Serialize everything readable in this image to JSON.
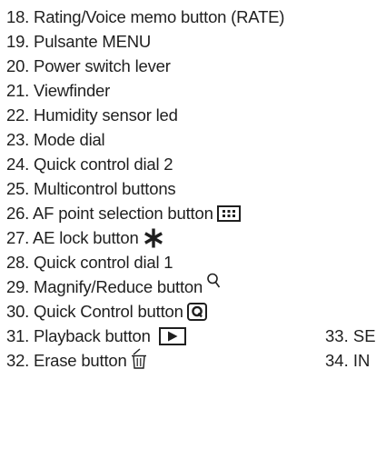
{
  "items": [
    {
      "label": "18. Rating/Voice memo button (RATE)"
    },
    {
      "label": "19. Pulsante MENU"
    },
    {
      "label": "20. Power switch lever"
    },
    {
      "label": "21. Viewfinder"
    },
    {
      "label": "22. Humidity sensor led"
    },
    {
      "label": "23. Mode dial"
    },
    {
      "label": "24. Quick control dial 2"
    },
    {
      "label": "25. Multicontrol buttons"
    },
    {
      "label": "26. AF point selection button",
      "icon": "af-point-selection-icon"
    },
    {
      "label": "27.  AE lock button",
      "icon": "asterisk-icon"
    },
    {
      "label": "28. Quick control dial 1"
    },
    {
      "label": "29. Magnify/Reduce button",
      "icon": "magnify-icon"
    },
    {
      "label": "30. Quick Control button",
      "icon": "q-button-icon"
    },
    {
      "label": "31. Playback button",
      "icon": "playback-icon"
    },
    {
      "label": "32. Erase button",
      "icon": "trash-icon"
    }
  ],
  "side_items": [
    {
      "label": "33. SE"
    },
    {
      "label": "34. IN"
    }
  ]
}
